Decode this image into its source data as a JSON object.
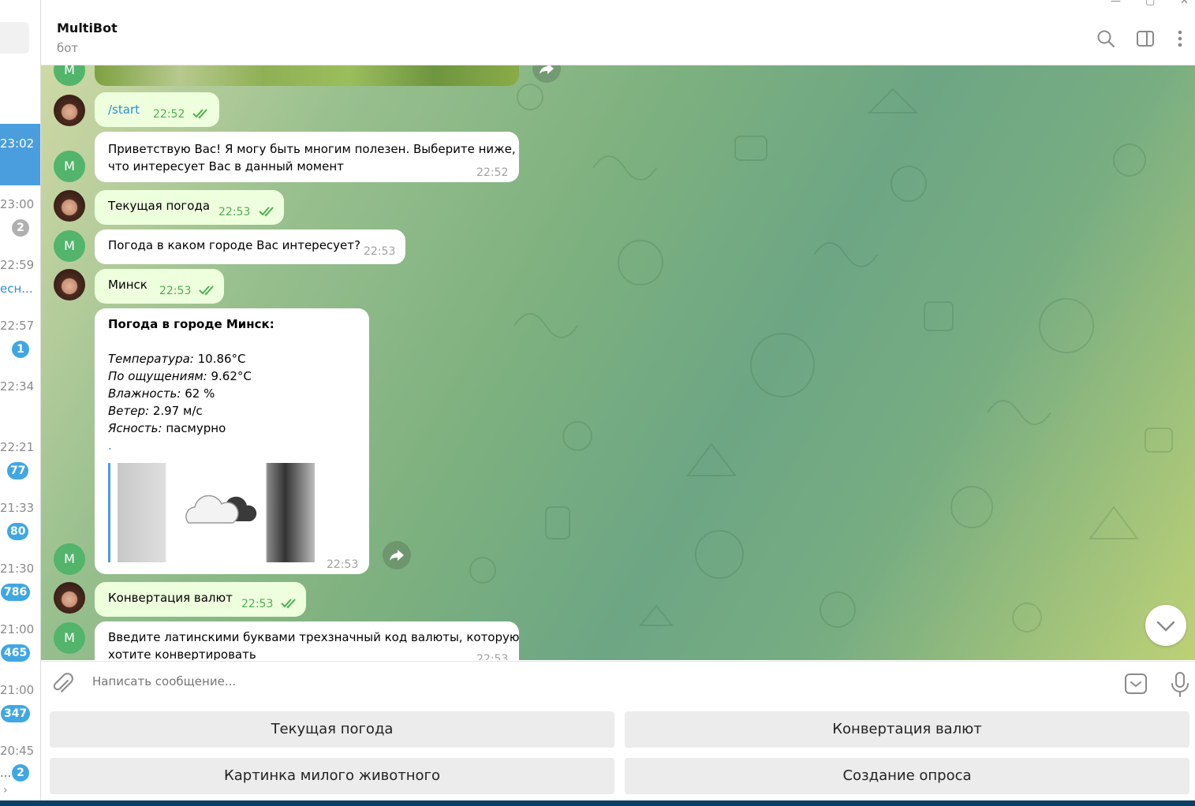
{
  "chat": {
    "title": "MultiBot",
    "subtitle": "бот"
  },
  "chat_list": {
    "items": [
      {
        "time": "23:02",
        "active": true
      },
      {
        "time": "23:00",
        "badge": "2",
        "badge_muted": true
      },
      {
        "time": "22:59",
        "snippet": "есн..."
      },
      {
        "time": "22:57",
        "badge": "1"
      },
      {
        "time": "22:34"
      },
      {
        "time": "22:21",
        "badge": "77"
      },
      {
        "time": "21:33",
        "badge": "80"
      },
      {
        "time": "21:30",
        "badge": "786"
      },
      {
        "time": "21:00",
        "badge": "465"
      },
      {
        "time": "21:00",
        "badge": "347"
      },
      {
        "time": "20:45",
        "badge": "2",
        "snippet": "..."
      }
    ]
  },
  "messages": {
    "m1": {
      "text": "/start",
      "time": "22:52"
    },
    "m2": {
      "line1": "Приветствую Вас! Я могу быть многим полезен. Выберите ниже,",
      "line2": "что интересует Вас в данный момент",
      "time": "22:52"
    },
    "m3": {
      "text": "Текущая погода",
      "time": "22:53"
    },
    "m4": {
      "text": "Погода в каком городе Вас интересует?",
      "time": "22:53"
    },
    "m5": {
      "text": "Минск",
      "time": "22:53"
    },
    "m6": {
      "heading": "Погода в городе Минск:",
      "rows": [
        {
          "label": "Температура:",
          "value": " 10.86°C"
        },
        {
          "label": "По ощущениям:",
          "value": " 9.62°C"
        },
        {
          "label": "Влажность:",
          "value": " 62 %"
        },
        {
          "label": "Ветер:",
          "value": " 2.97 м/с"
        },
        {
          "label": "Ясность:",
          "value": " пасмурно"
        }
      ],
      "dot": ".",
      "time": "22:53"
    },
    "m7": {
      "text": "Конвертация валют",
      "time": "22:53"
    },
    "m8": {
      "line1": "Введите латинскими буквами трехзначный код валюты, которую",
      "line2": "хотите конвертировать",
      "time": "22:53"
    }
  },
  "avatars": {
    "bot_letter": "M"
  },
  "composer": {
    "placeholder": "Написать сообщение..."
  },
  "keyboard": {
    "btn1": "Текущая погода",
    "btn2": "Конвертация валют",
    "btn3": "Картинка милого животного",
    "btn4": "Создание опроса"
  },
  "icons": [
    "search-icon",
    "sidebar-toggle-icon",
    "more-vertical-icon",
    "attach-icon",
    "bot-keyboard-icon",
    "microphone-icon",
    "forward-icon",
    "chevron-down-icon",
    "double-check-icon",
    "cloud-icon"
  ],
  "colors": {
    "accent": "#40a7e3",
    "outgoing_bubble": "#eeffde",
    "bot_avatar": "#53b46b",
    "active_chat": "#4a9ede"
  }
}
